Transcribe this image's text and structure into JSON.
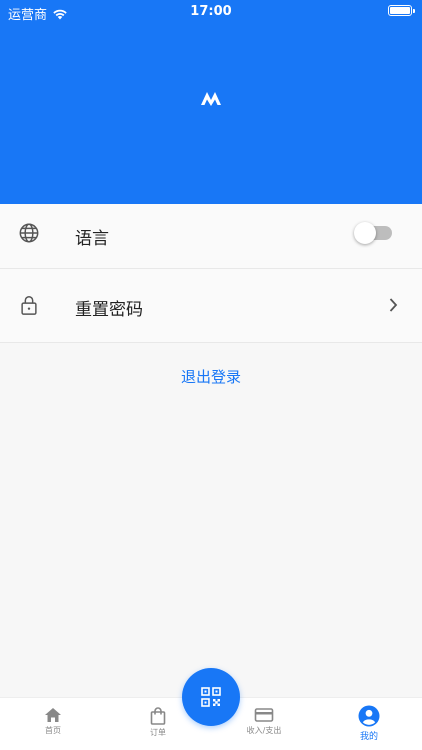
{
  "status_bar": {
    "carrier": "运营商",
    "time": "17:00"
  },
  "header": {
    "logo_icon": "brand-logo-icon",
    "background": "#1877f6"
  },
  "settings": {
    "language": {
      "label": "语言",
      "icon": "globe-icon",
      "toggle_on": false
    },
    "reset_password": {
      "label": "重置密码",
      "icon": "lock-icon",
      "chevron": "chevron-right-icon"
    },
    "logout_label": "退出登录"
  },
  "tabbar": {
    "tabs": [
      {
        "label": "首页",
        "icon": "home-icon",
        "active": false
      },
      {
        "label": "订单",
        "icon": "shopping-bag-icon",
        "active": false
      },
      {
        "label": "收入/支出",
        "icon": "credit-card-icon",
        "active": false
      },
      {
        "label": "我的",
        "icon": "user-circle-icon",
        "active": true
      }
    ],
    "center_button_icon": "qr-code-icon"
  },
  "colors": {
    "accent": "#1877f6",
    "inactive_tab": "#888888",
    "text": "#222222"
  }
}
